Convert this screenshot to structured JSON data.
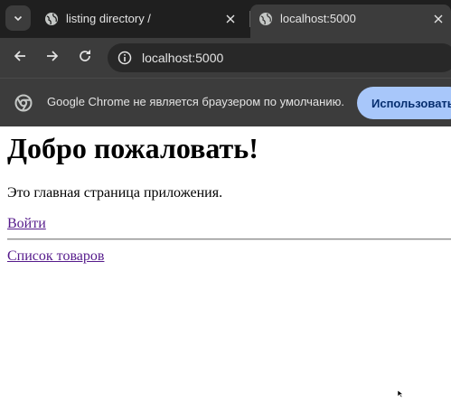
{
  "browser": {
    "tabs": [
      {
        "title": "listing directory /",
        "icon": "globe-icon",
        "active": false
      },
      {
        "title": "localhost:5000",
        "icon": "globe-icon",
        "active": true
      }
    ],
    "address_bar": {
      "url": "localhost:5000",
      "icon": "info-icon"
    },
    "infobar": {
      "message": "Google Chrome не является браузером по умолчанию.",
      "button_label": "Использовать"
    },
    "colors": {
      "tabstrip": "#1f1f1f",
      "toolbar": "#3c3c3c",
      "button": "#a8c7fa",
      "link": "#551a8b"
    }
  },
  "page": {
    "heading": "Добро пожаловать!",
    "intro": "Это главная страница приложения.",
    "links": {
      "login": "Войти",
      "products": "Список товаров"
    }
  }
}
